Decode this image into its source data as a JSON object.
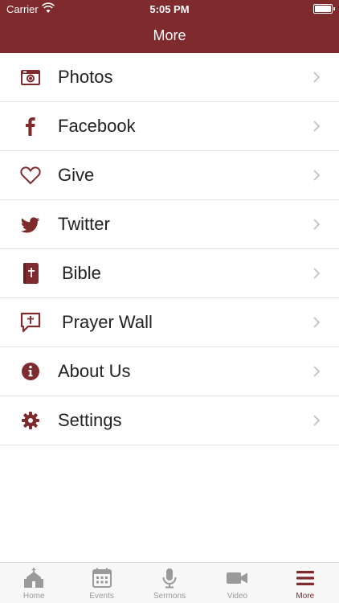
{
  "status_bar": {
    "carrier": "Carrier",
    "time": "5:05 PM",
    "battery_level": 1.0
  },
  "header": {
    "title": "More"
  },
  "menu": {
    "items": [
      {
        "label": "Photos",
        "icon": "camera-icon"
      },
      {
        "label": "Facebook",
        "icon": "facebook-icon"
      },
      {
        "label": "Give",
        "icon": "heart-icon"
      },
      {
        "label": "Twitter",
        "icon": "twitter-icon"
      },
      {
        "label": "Bible",
        "icon": "bible-icon"
      },
      {
        "label": "Prayer Wall",
        "icon": "prayer-chat-icon"
      },
      {
        "label": "About Us",
        "icon": "info-icon"
      },
      {
        "label": "Settings",
        "icon": "gear-icon"
      }
    ]
  },
  "tab_bar": {
    "tabs": [
      {
        "label": "Home",
        "icon": "church-icon"
      },
      {
        "label": "Events",
        "icon": "calendar-icon"
      },
      {
        "label": "Sermons",
        "icon": "microphone-icon"
      },
      {
        "label": "Video",
        "icon": "video-camera-icon"
      },
      {
        "label": "More",
        "icon": "menu-icon"
      }
    ],
    "active": "More"
  },
  "colors": {
    "brand": "#7f2a2c",
    "inactive_tab": "#9a9a9a",
    "chevron": "#c7c7cc"
  }
}
